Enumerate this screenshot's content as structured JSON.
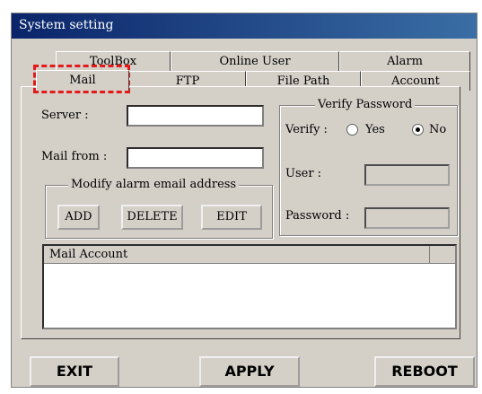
{
  "window": {
    "title": "System setting"
  },
  "tabs": {
    "row1": [
      {
        "label": "ToolBox"
      },
      {
        "label": "Online User"
      },
      {
        "label": "Alarm"
      }
    ],
    "row2": [
      {
        "label": "Mail",
        "active": true
      },
      {
        "label": "FTP"
      },
      {
        "label": "File Path"
      },
      {
        "label": "Account"
      }
    ]
  },
  "mail": {
    "server_label": "Server :",
    "server_value": "",
    "mail_from_label": "Mail from :",
    "mail_from_value": "",
    "modify_group_title": "Modify alarm email address",
    "add_label": "ADD",
    "delete_label": "DELETE",
    "edit_label": "EDIT",
    "account_column": "Mail Account"
  },
  "verify": {
    "group_title": "Verify Password",
    "verify_label": "Verify :",
    "yes_label": "Yes",
    "no_label": "No",
    "selected": "No",
    "user_label": "User :",
    "password_label": "Password :"
  },
  "footer": {
    "exit_label": "EXIT",
    "apply_label": "APPLY",
    "reboot_label": "REBOOT"
  },
  "colors": {
    "highlight": "#e21a1a",
    "titlebar": "#0a246a",
    "face": "#d4d0c8"
  }
}
